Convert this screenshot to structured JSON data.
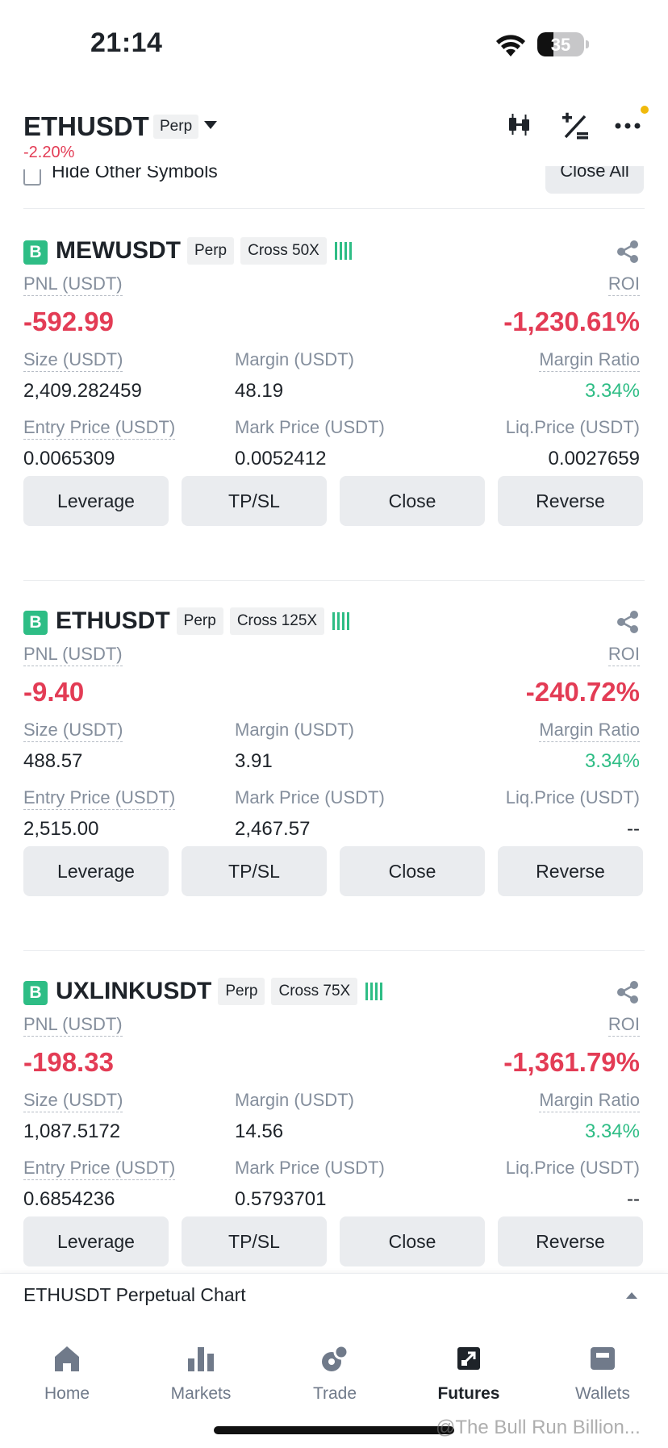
{
  "status_bar": {
    "time": "21:14",
    "battery": "35",
    "battery_level": 0.35
  },
  "header": {
    "symbol": "ETHUSDT",
    "type": "Perp",
    "change": "-2.20%"
  },
  "toolbar": {
    "hide_label": "Hide Other Symbols",
    "close_all": "Close All"
  },
  "labels": {
    "pnl": "PNL (USDT)",
    "roi": "ROI",
    "size": "Size (USDT)",
    "margin": "Margin (USDT)",
    "margin_ratio": "Margin Ratio",
    "entry": "Entry Price (USDT)",
    "mark": "Mark Price (USDT)",
    "liq": "Liq.Price (USDT)"
  },
  "buttons": {
    "leverage": "Leverage",
    "tpsl": "TP/SL",
    "close": "Close",
    "reverse": "Reverse"
  },
  "positions": [
    {
      "symbol": "MEWUSDT",
      "type": "Perp",
      "mode": "Cross 50X",
      "badge": "B",
      "pnl": "-592.99",
      "roi": "-1,230.61%",
      "size": "2,409.282459",
      "margin": "48.19",
      "margin_ratio": "3.34%",
      "entry": "0.0065309",
      "mark": "0.0052412",
      "liq": "0.0027659"
    },
    {
      "symbol": "ETHUSDT",
      "type": "Perp",
      "mode": "Cross 125X",
      "badge": "B",
      "pnl": "-9.40",
      "roi": "-240.72%",
      "size": "488.57",
      "margin": "3.91",
      "margin_ratio": "3.34%",
      "entry": "2,515.00",
      "mark": "2,467.57",
      "liq": "--"
    },
    {
      "symbol": "UXLINKUSDT",
      "type": "Perp",
      "mode": "Cross 75X",
      "badge": "B",
      "pnl": "-198.33",
      "roi": "-1,361.79%",
      "size": "1,087.5172",
      "margin": "14.56",
      "margin_ratio": "3.34%",
      "entry": "0.6854236",
      "mark": "0.5793701",
      "liq": "--"
    }
  ],
  "chart_bar": {
    "label": "ETHUSDT Perpetual  Chart"
  },
  "nav": [
    {
      "label": "Home",
      "icon": "home-icon"
    },
    {
      "label": "Markets",
      "icon": "markets-icon"
    },
    {
      "label": "Trade",
      "icon": "trade-icon"
    },
    {
      "label": "Futures",
      "icon": "futures-icon",
      "active": true
    },
    {
      "label": "Wallets",
      "icon": "wallet-icon"
    }
  ],
  "watermark": "@The Bull Run Billion..."
}
